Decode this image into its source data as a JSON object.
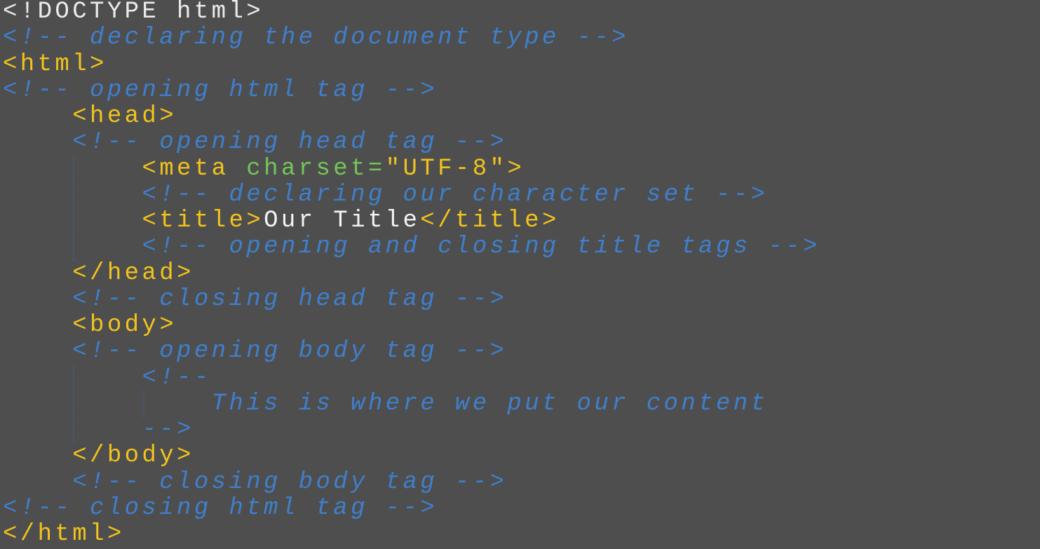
{
  "editor": {
    "colors": {
      "background": "#4e4e4e",
      "comment": "#3f7fcc",
      "tag": "#f2c31c",
      "attribute": "#74c55a",
      "text": "#f4f4f4"
    },
    "lines": [
      {
        "indent": 0,
        "tokens": [
          {
            "type": "doctype",
            "text": "<!DOCTYPE html>"
          }
        ]
      },
      {
        "indent": 0,
        "tokens": [
          {
            "type": "comment",
            "text": "<!-- declaring the document type -->"
          }
        ]
      },
      {
        "indent": 0,
        "tokens": [
          {
            "type": "tag",
            "text": "<html>"
          }
        ]
      },
      {
        "indent": 0,
        "tokens": [
          {
            "type": "comment",
            "text": "<!-- opening html tag -->"
          }
        ]
      },
      {
        "indent": 4,
        "tokens": [
          {
            "type": "tag",
            "text": "<head>"
          }
        ]
      },
      {
        "indent": 4,
        "tokens": [
          {
            "type": "comment",
            "text": "<!-- opening head tag -->"
          }
        ]
      },
      {
        "indent": 8,
        "tokens": [
          {
            "type": "tag",
            "text": "<meta "
          },
          {
            "type": "attr",
            "text": "charset="
          },
          {
            "type": "string",
            "text": "\"UTF-8\""
          },
          {
            "type": "tag",
            "text": ">"
          }
        ]
      },
      {
        "indent": 8,
        "tokens": [
          {
            "type": "comment",
            "text": "<!-- declaring our character set -->"
          }
        ]
      },
      {
        "indent": 8,
        "tokens": [
          {
            "type": "tag",
            "text": "<title>"
          },
          {
            "type": "text",
            "text": "Our Title"
          },
          {
            "type": "tag",
            "text": "</title>"
          }
        ]
      },
      {
        "indent": 8,
        "tokens": [
          {
            "type": "comment",
            "text": "<!-- opening and closing title tags -->"
          }
        ]
      },
      {
        "indent": 4,
        "tokens": [
          {
            "type": "tag",
            "text": "</head>"
          }
        ]
      },
      {
        "indent": 4,
        "tokens": [
          {
            "type": "comment",
            "text": "<!-- closing head tag -->"
          }
        ]
      },
      {
        "indent": 4,
        "tokens": [
          {
            "type": "tag",
            "text": "<body>"
          }
        ]
      },
      {
        "indent": 4,
        "tokens": [
          {
            "type": "comment",
            "text": "<!-- opening body tag -->"
          }
        ]
      },
      {
        "indent": 8,
        "tokens": [
          {
            "type": "comment",
            "text": "<!--"
          }
        ]
      },
      {
        "indent": 12,
        "tokens": [
          {
            "type": "comment",
            "text": "This is where we put our content"
          }
        ]
      },
      {
        "indent": 8,
        "tokens": [
          {
            "type": "comment",
            "text": "-->"
          }
        ]
      },
      {
        "indent": 4,
        "tokens": [
          {
            "type": "tag",
            "text": "</body>"
          }
        ]
      },
      {
        "indent": 4,
        "tokens": [
          {
            "type": "comment",
            "text": "<!-- closing body tag -->"
          }
        ]
      },
      {
        "indent": 0,
        "tokens": [
          {
            "type": "comment",
            "text": "<!-- closing html tag -->"
          }
        ]
      },
      {
        "indent": 0,
        "tokens": [
          {
            "type": "tag",
            "text": "</html>"
          }
        ]
      }
    ]
  }
}
